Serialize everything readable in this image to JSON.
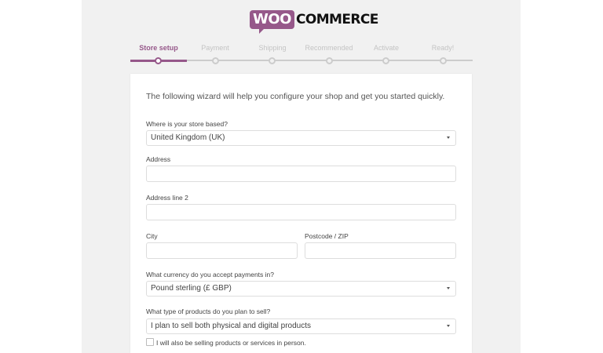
{
  "brand": {
    "badge": "WOO",
    "text": "COMMERCE",
    "color": "#96588a"
  },
  "steps": [
    {
      "label": "Store setup",
      "active": true
    },
    {
      "label": "Payment",
      "active": false
    },
    {
      "label": "Shipping",
      "active": false
    },
    {
      "label": "Recommended",
      "active": false
    },
    {
      "label": "Activate",
      "active": false
    },
    {
      "label": "Ready!",
      "active": false
    }
  ],
  "form": {
    "intro": "The following wizard will help you configure your shop and get you started quickly.",
    "country": {
      "label": "Where is your store based?",
      "value": "United Kingdom (UK)"
    },
    "address": {
      "label": "Address",
      "value": ""
    },
    "address2": {
      "label": "Address line 2",
      "value": ""
    },
    "city": {
      "label": "City",
      "value": ""
    },
    "postcode": {
      "label": "Postcode / ZIP",
      "value": ""
    },
    "currency": {
      "label": "What currency do you accept payments in?",
      "value": "Pound sterling (£ GBP)"
    },
    "product_type": {
      "label": "What type of products do you plan to sell?",
      "value": "I plan to sell both physical and digital products"
    },
    "in_person": {
      "label": "I will also be selling products or services in person.",
      "checked": false
    }
  }
}
